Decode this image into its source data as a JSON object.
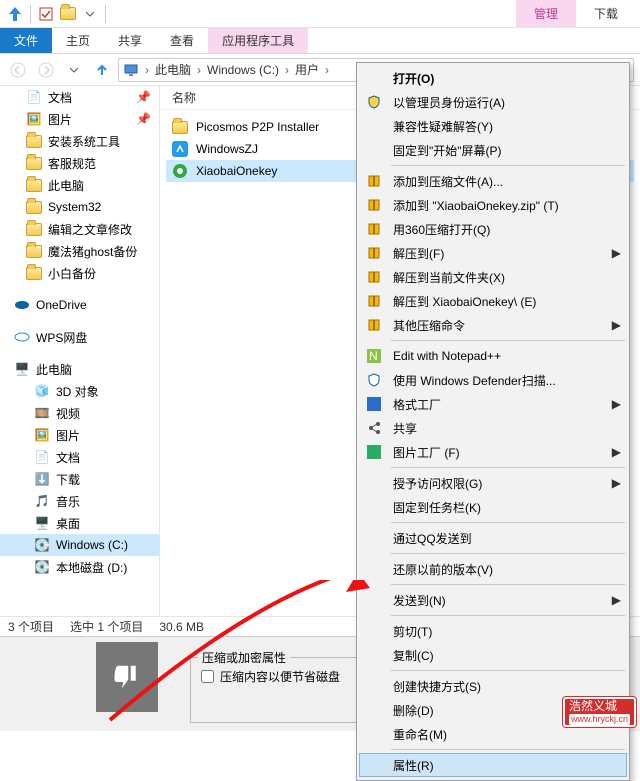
{
  "title_tabs": {
    "manage": "管理",
    "download": "下载"
  },
  "ribbon": {
    "file": "文件",
    "home": "主页",
    "share": "共享",
    "view": "查看",
    "app_tools": "应用程序工具"
  },
  "breadcrumb": [
    "此电脑",
    "Windows (C:)",
    "用户"
  ],
  "nav_header": "名称",
  "quick": {
    "docs": "文档",
    "pics": "图片",
    "install": "安装系统工具",
    "kf": "客服规范",
    "thispc": "此电脑",
    "sys32": "System32",
    "editor": "编辑之文章修改",
    "ghost": "魔法猪ghost备份",
    "xb": "小白备份"
  },
  "roots": {
    "onedrive": "OneDrive",
    "wps": "WPS网盘",
    "thispc": "此电脑",
    "obj3d": "3D 对象",
    "video": "视频",
    "pics": "图片",
    "docs": "文档",
    "download": "下载",
    "music": "音乐",
    "desktop": "桌面",
    "cdrive": "Windows (C:)",
    "ddrive": "本地磁盘 (D:)"
  },
  "files": [
    {
      "name": "Picosmos P2P Installer",
      "kind": "folder"
    },
    {
      "name": "WindowsZJ",
      "kind": "app-blue"
    },
    {
      "name": "XiaobaiOnekey",
      "kind": "app-green",
      "selected": true
    }
  ],
  "status": {
    "count": "3 个项目",
    "selected": "选中 1 个项目",
    "size": "30.6 MB"
  },
  "bottom": {
    "group_title": "压缩或加密属性",
    "checkbox": "压缩内容以便节省磁盘"
  },
  "context_menu": [
    {
      "label": "打开(O)",
      "bold": true
    },
    {
      "label": "以管理员身份运行(A)",
      "icon": "shield"
    },
    {
      "label": "兼容性疑难解答(Y)"
    },
    {
      "label": "固定到\"开始\"屏幕(P)"
    },
    {
      "sep": true
    },
    {
      "label": "添加到压缩文件(A)...",
      "icon": "archive"
    },
    {
      "label": "添加到 \"XiaobaiOnekey.zip\" (T)",
      "icon": "archive"
    },
    {
      "label": "用360压缩打开(Q)",
      "icon": "archive"
    },
    {
      "label": "解压到(F)",
      "icon": "archive",
      "submenu": true
    },
    {
      "label": "解压到当前文件夹(X)",
      "icon": "archive"
    },
    {
      "label": "解压到 XiaobaiOnekey\\ (E)",
      "icon": "archive"
    },
    {
      "label": "其他压缩命令",
      "icon": "archive",
      "submenu": true
    },
    {
      "sep": true
    },
    {
      "label": "Edit with Notepad++",
      "icon": "npp"
    },
    {
      "label": "使用 Windows Defender扫描...",
      "icon": "defender"
    },
    {
      "label": "格式工厂",
      "icon": "ff",
      "submenu": true
    },
    {
      "label": "共享",
      "icon": "share"
    },
    {
      "label": "图片工厂 (F)",
      "icon": "pf",
      "submenu": true
    },
    {
      "sep": true
    },
    {
      "label": "授予访问权限(G)",
      "submenu": true
    },
    {
      "label": "固定到任务栏(K)"
    },
    {
      "sep": true
    },
    {
      "label": "通过QQ发送到"
    },
    {
      "sep": true
    },
    {
      "label": "还原以前的版本(V)"
    },
    {
      "sep": true
    },
    {
      "label": "发送到(N)",
      "submenu": true
    },
    {
      "sep": true
    },
    {
      "label": "剪切(T)"
    },
    {
      "label": "复制(C)"
    },
    {
      "sep": true
    },
    {
      "label": "创建快捷方式(S)"
    },
    {
      "label": "删除(D)"
    },
    {
      "label": "重命名(M)"
    },
    {
      "sep": true
    },
    {
      "label": "属性(R)",
      "hover": true
    }
  ],
  "watermark": {
    "top": "浩然义城",
    "bottom": "www.hryckj.cn"
  }
}
